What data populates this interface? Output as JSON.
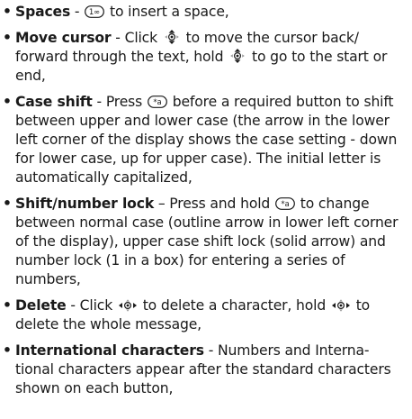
{
  "items": [
    {
      "term": "Spaces",
      "sep": " - ",
      "parts": [
        " to insert a space,"
      ],
      "icons": [
        {
          "name": "key-0-icon",
          "label": "1∞"
        }
      ]
    },
    {
      "term": "Move cursor",
      "sep": " - Click ",
      "parts": [
        " to move the cursor back/ forward through the text, hold ",
        " to go to the start or end,"
      ],
      "icons": [
        {
          "name": "joystick-up-down-icon"
        },
        {
          "name": "joystick-up-down-icon"
        }
      ]
    },
    {
      "term": "Case shift",
      "sep": " - Press ",
      "parts": [
        " before a required button to shift between upper and lower case (the arrow in the lower left corner of the display shows the case setting - down for lower case, up for upper case). The initial letter is automatically capitalized,"
      ],
      "icons": [
        {
          "name": "key-star-icon",
          "label": "*a"
        }
      ]
    },
    {
      "term": "Shift/number lock",
      "sep": " – Press and hold ",
      "parts": [
        " to change between normal case (outline arrow in lower left corner of the display), upper case shift lock (solid arrow) and number lock (1 in a box) for entering a series of numbers,"
      ],
      "icons": [
        {
          "name": "key-star-icon",
          "label": "*a"
        }
      ]
    },
    {
      "term": "Delete",
      "sep": " - Click ",
      "parts": [
        " to delete a character, hold ",
        " to delete the whole message,"
      ],
      "icons": [
        {
          "name": "joystick-left-right-icon"
        },
        {
          "name": "joystick-left-right-icon"
        }
      ]
    },
    {
      "term": "International characters",
      "sep": " - Numbers and Interna- tional characters appear after the standard characters shown on each button,",
      "parts": [],
      "icons": []
    }
  ]
}
